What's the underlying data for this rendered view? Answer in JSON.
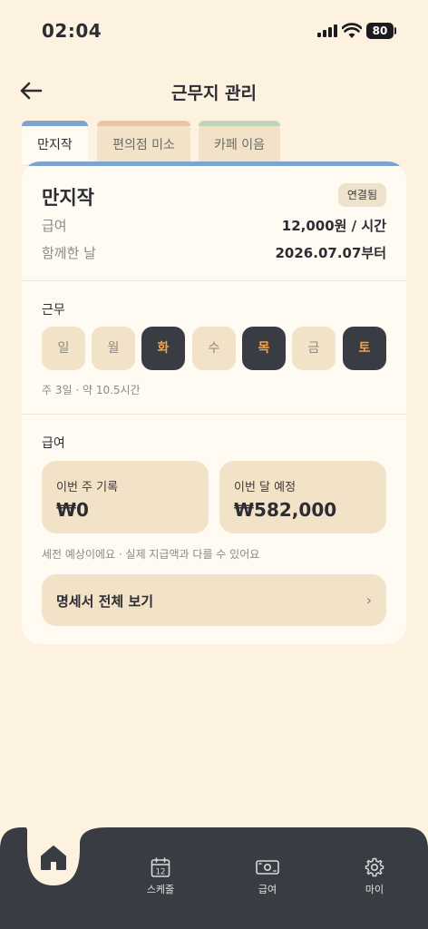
{
  "status_bar": {
    "time": "02:04",
    "battery": "80"
  },
  "header": {
    "title": "근무지 관리"
  },
  "tabs": [
    {
      "label": "만지작"
    },
    {
      "label": "편의점 미소"
    },
    {
      "label": "카페 이음"
    }
  ],
  "card": {
    "name": "만지작",
    "badge": "연결됨",
    "wage_label": "급여",
    "wage_value": "12,000원 / 시간",
    "since_label": "함께한 날",
    "since_value": "2026.07.07부터"
  },
  "schedule": {
    "title": "근무",
    "days": [
      {
        "label": "일",
        "active": false
      },
      {
        "label": "월",
        "active": false
      },
      {
        "label": "화",
        "active": true
      },
      {
        "label": "수",
        "active": false
      },
      {
        "label": "목",
        "active": true
      },
      {
        "label": "금",
        "active": false
      },
      {
        "label": "토",
        "active": true
      }
    ],
    "summary": "주 3일 · 약 10.5시간"
  },
  "pay": {
    "title": "급여",
    "this_week_label": "이번 주 기록",
    "this_week_value": "₩0",
    "this_month_label": "이번 달 예정",
    "this_month_value": "₩582,000",
    "note": "세전 예상이에요 · 실제 지급액과 다를 수 있어요",
    "statement_label": "명세서 전체 보기",
    "chevron": "›"
  },
  "bottom_nav": {
    "items": [
      {
        "label": "스케줄",
        "icon": "calendar-icon",
        "badge": "12"
      },
      {
        "label": "급여",
        "icon": "money-icon"
      },
      {
        "label": "마이",
        "icon": "gear-icon"
      }
    ]
  },
  "colors": {
    "background": "#fdf1df",
    "card": "#fffaf2",
    "chip": "#f1e2c8",
    "dark": "#393c42",
    "accent": "#f4a24a",
    "tab_blue": "#7ea5cf",
    "tab_peach": "#ecc4a4",
    "tab_green": "#bfd4b8"
  }
}
